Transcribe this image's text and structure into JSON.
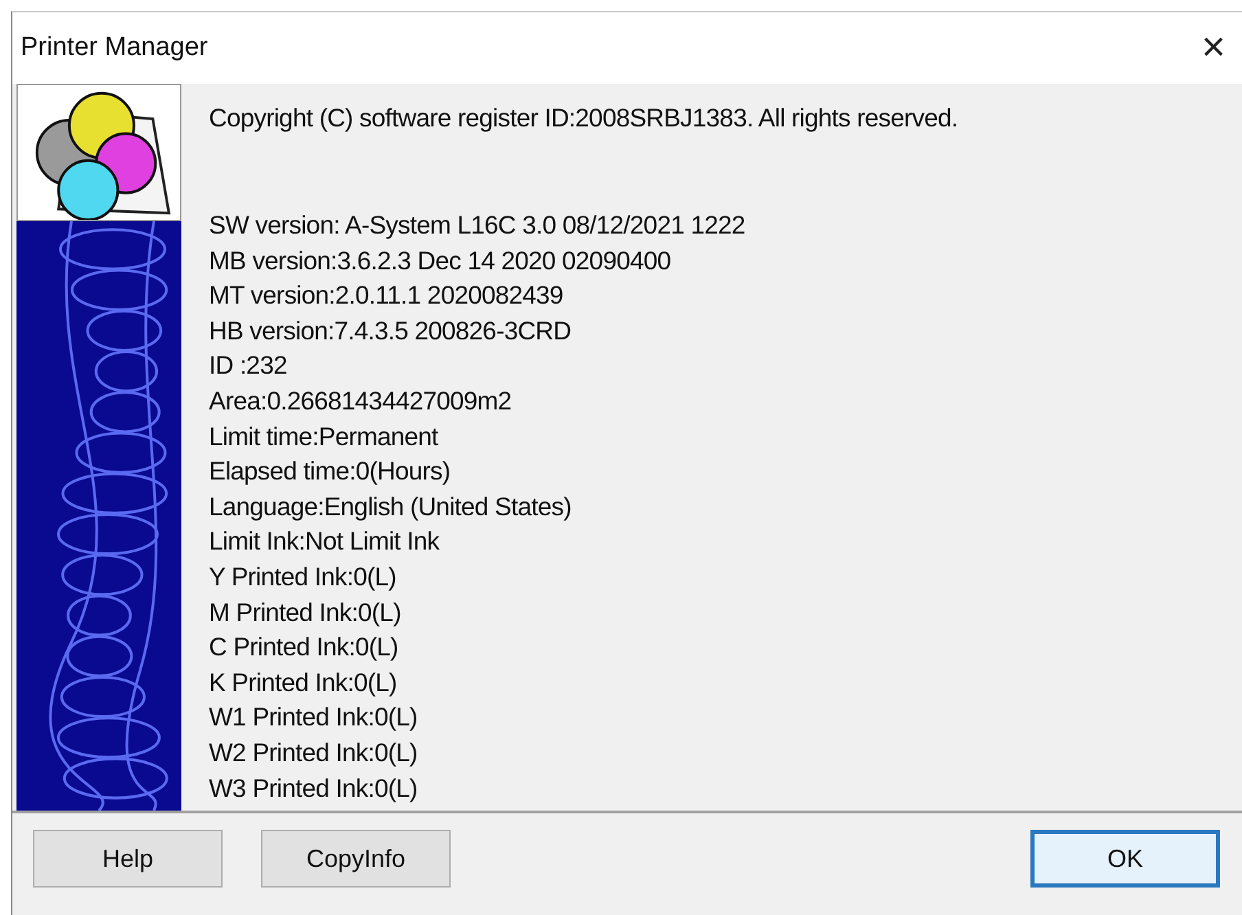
{
  "window": {
    "title": "Printer Manager",
    "close": "×"
  },
  "copyright": "Copyright (C) software register ID:2008SRBJ1383. All rights reserved.",
  "info_lines": [
    "SW version: A-System L16C 3.0 08/12/2021 1222",
    "MB version:3.6.2.3 Dec 14 2020 02090400",
    "MT version:2.0.11.1 2020082439",
    "HB version:7.4.3.5 200826-3CRD",
    "ID :232",
    "Area:0.26681434427009m2",
    "Limit time:Permanent",
    "Elapsed time:0(Hours)",
    "Language:English (United States)",
    "Limit Ink:Not Limit Ink",
    "Y Printed Ink:0(L)",
    "M Printed Ink:0(L)",
    "C Printed Ink:0(L)",
    "K Printed Ink:0(L)",
    "W1 Printed Ink:0(L)",
    "W2 Printed Ink:0(L)",
    "W3 Printed Ink:0(L)"
  ],
  "buttons": [
    {
      "label": "Help",
      "default": false
    },
    {
      "label": "CopyInfo",
      "default": false
    },
    {
      "label": "OK",
      "default": true
    }
  ]
}
